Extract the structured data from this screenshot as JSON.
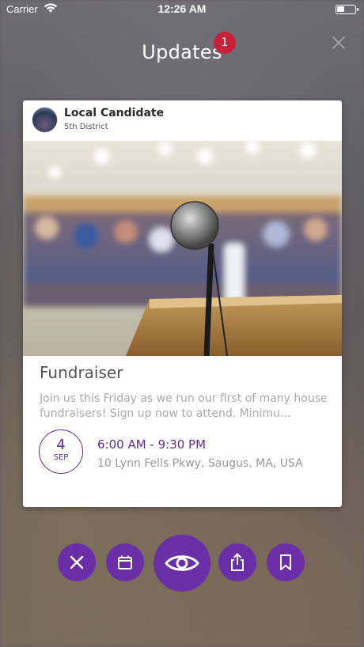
{
  "status_bar": {
    "carrier": "Carrier",
    "time": "12:26 AM",
    "icons": [
      "wifi-icon",
      "battery-icon"
    ]
  },
  "header": {
    "title": "Updates",
    "badge_count": "1",
    "close_icon": "close-icon"
  },
  "card": {
    "author": {
      "name": "Local Candidate",
      "district": "5th District"
    },
    "event": {
      "title": "Fundraiser",
      "description": "Join us this Friday as we run our first of many house fundraisers! Sign up now to attend. Minimu...",
      "date_day": "4",
      "date_month": "SEP",
      "time": "6:00 AM - 9:30 PM",
      "location": "10 Lynn Fells Pkwy, Saugus, MA, USA"
    }
  },
  "actions": {
    "buttons": [
      "dismiss-icon",
      "calendar-icon",
      "eye-icon",
      "share-icon",
      "bookmark-icon"
    ]
  },
  "colors": {
    "accent": "#6a2fa6",
    "badge": "#c8223a",
    "card_bg": "#ffffff"
  }
}
